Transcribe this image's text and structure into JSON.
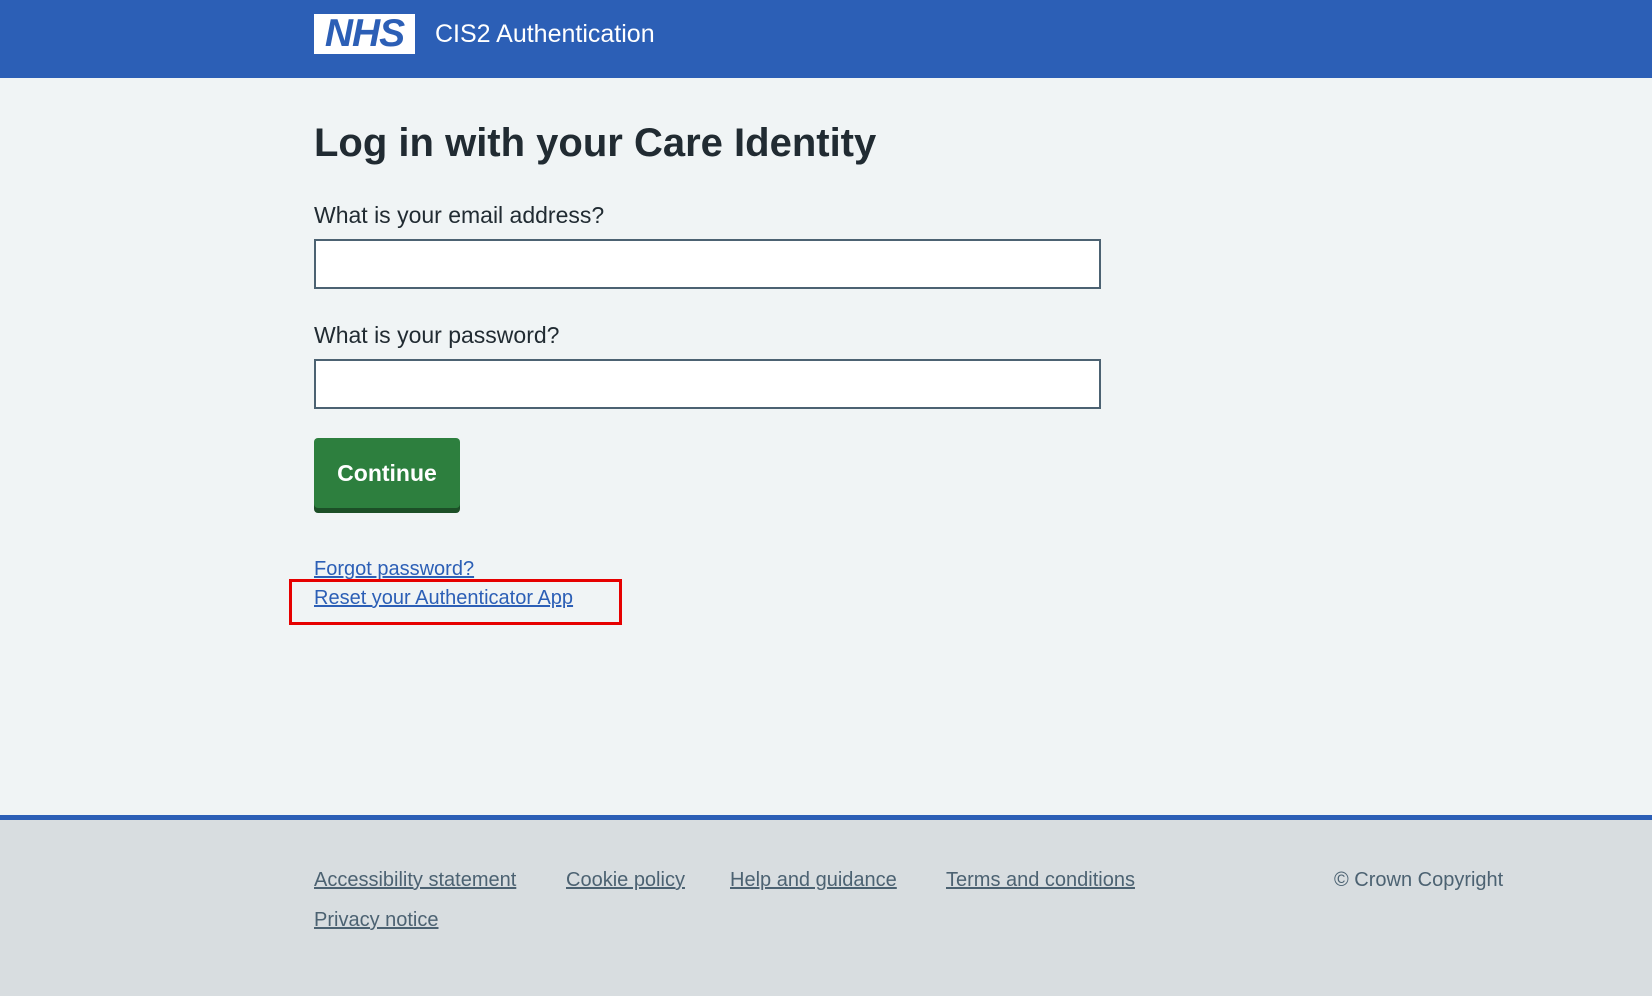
{
  "header": {
    "logo_text": "NHS",
    "service_name": "CIS2 Authentication"
  },
  "main": {
    "title": "Log in with your Care Identity",
    "email_label": "What is your email address?",
    "email_value": "",
    "password_label": "What is your password?",
    "password_value": "",
    "continue_label": "Continue",
    "forgot_password_link": "Forgot password?",
    "reset_authenticator_link": "Reset your Authenticator App"
  },
  "footer": {
    "links": [
      {
        "label": "Accessibility statement"
      },
      {
        "label": "Cookie policy"
      },
      {
        "label": "Help and guidance"
      },
      {
        "label": "Terms and conditions"
      },
      {
        "label": "Privacy notice"
      }
    ],
    "copyright": "© Crown Copyright"
  },
  "colors": {
    "header_blue": "#2c5fb6",
    "button_green": "#2d7f3e",
    "link_blue": "#2c5fb6",
    "highlight_red": "#e60000"
  }
}
